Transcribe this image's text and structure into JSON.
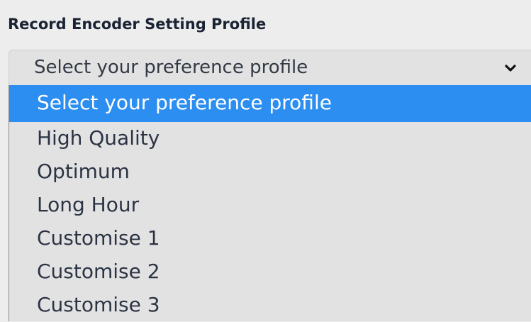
{
  "section": {
    "heading": "Record Encoder Setting Profile"
  },
  "select": {
    "value": "Select your preference profile",
    "icon": "chevron-down-icon"
  },
  "options": [
    "Select your preference profile",
    "High Quality",
    "Optimum",
    "Long Hour",
    "Customise 1",
    "Customise 2",
    "Customise 3"
  ],
  "highlighted_option_index": 0,
  "colors": {
    "highlight": "#2b8ef0",
    "background": "#ededed",
    "select_background": "#e2e2e2"
  }
}
